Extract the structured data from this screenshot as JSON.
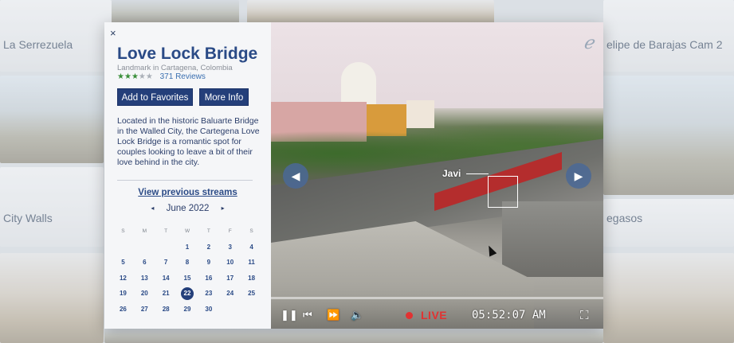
{
  "background": {
    "tiles": [
      {
        "label": "La Serrezuela"
      },
      {
        "label": ""
      },
      {
        "label": ""
      },
      {
        "label": "elipe de Barajas Cam 2"
      },
      {
        "label": "City Walls"
      },
      {
        "label": ""
      },
      {
        "label": ""
      },
      {
        "label": "egasos"
      }
    ]
  },
  "modal": {
    "close_label": "×",
    "title": "Love Lock Bridge",
    "subtitle": "Landmark in Cartagena, Colombia",
    "rating": {
      "filled": 3,
      "total": 5
    },
    "reviews": "371 Reviews",
    "buttons": {
      "favorites": "Add to Favorites",
      "more_info": "More Info"
    },
    "description": "Located in the historic Baluarte Bridge in the Walled City, the Cartegena Love Lock Bridge is a romantic spot for couples looking to leave a bit of their love behind in the city.",
    "prev_streams": "View previous streams",
    "calendar": {
      "month": "June 2022",
      "prev_arrow": "◂",
      "next_arrow": "▸",
      "weekdays": [
        "S",
        "M",
        "T",
        "W",
        "T",
        "F",
        "S"
      ],
      "weeks": [
        [
          "",
          "",
          "",
          "1",
          "2",
          "3",
          "4"
        ],
        [
          "5",
          "6",
          "7",
          "8",
          "9",
          "10",
          "11"
        ],
        [
          "12",
          "13",
          "14",
          "15",
          "16",
          "17",
          "18"
        ],
        [
          "19",
          "20",
          "21",
          "22",
          "23",
          "24",
          "25"
        ],
        [
          "26",
          "27",
          "28",
          "29",
          "30",
          "",
          ""
        ]
      ],
      "selected": "22"
    }
  },
  "video": {
    "logo": "ℯ",
    "tag_label": "Javi",
    "live_label": "LIVE",
    "time": "05:52:07 AM",
    "colors": {
      "live": "#e23232",
      "accent": "#243f7a"
    }
  }
}
